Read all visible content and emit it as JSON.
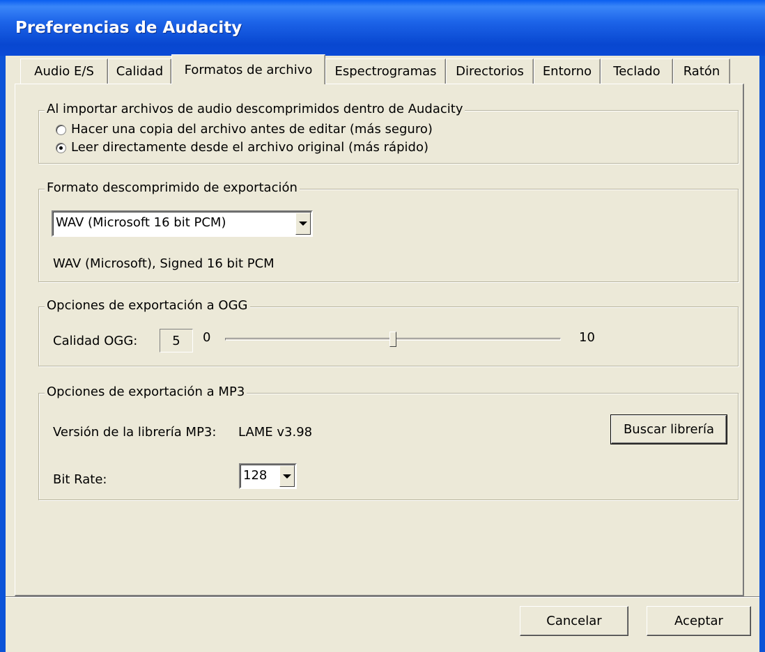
{
  "window": {
    "title": "Preferencias de Audacity"
  },
  "tabs": [
    {
      "label": "Audio E/S"
    },
    {
      "label": "Calidad"
    },
    {
      "label": "Formatos de archivo",
      "active": true
    },
    {
      "label": "Espectrogramas"
    },
    {
      "label": "Directorios"
    },
    {
      "label": "Entorno"
    },
    {
      "label": "Teclado"
    },
    {
      "label": "Ratón"
    }
  ],
  "import_group": {
    "legend": "Al importar archivos de audio descomprimidos dentro de Audacity",
    "options": [
      {
        "label": "Hacer una copia del archivo antes de editar (más seguro)",
        "selected": false
      },
      {
        "label": "Leer directamente desde el archivo original (más rápido)",
        "selected": true
      }
    ]
  },
  "export_format_group": {
    "legend": "Formato descomprimido de exportación",
    "selected_format": "WAV (Microsoft 16 bit PCM)",
    "description": "WAV (Microsoft), Signed 16 bit PCM"
  },
  "ogg_group": {
    "legend": "Opciones de exportación a OGG",
    "quality_label": "Calidad OGG:",
    "quality_value": "5",
    "min_label": "0",
    "max_label": "10",
    "slider_fraction": 0.5
  },
  "mp3_group": {
    "legend": "Opciones de exportación a MP3",
    "library_label": "Versión de la librería MP3:",
    "library_value": "LAME v3.98",
    "find_library_button": "Buscar librería",
    "bitrate_label": "Bit Rate:",
    "bitrate_value": "128"
  },
  "footer": {
    "cancel_button": "Cancelar",
    "ok_button": "Aceptar"
  }
}
